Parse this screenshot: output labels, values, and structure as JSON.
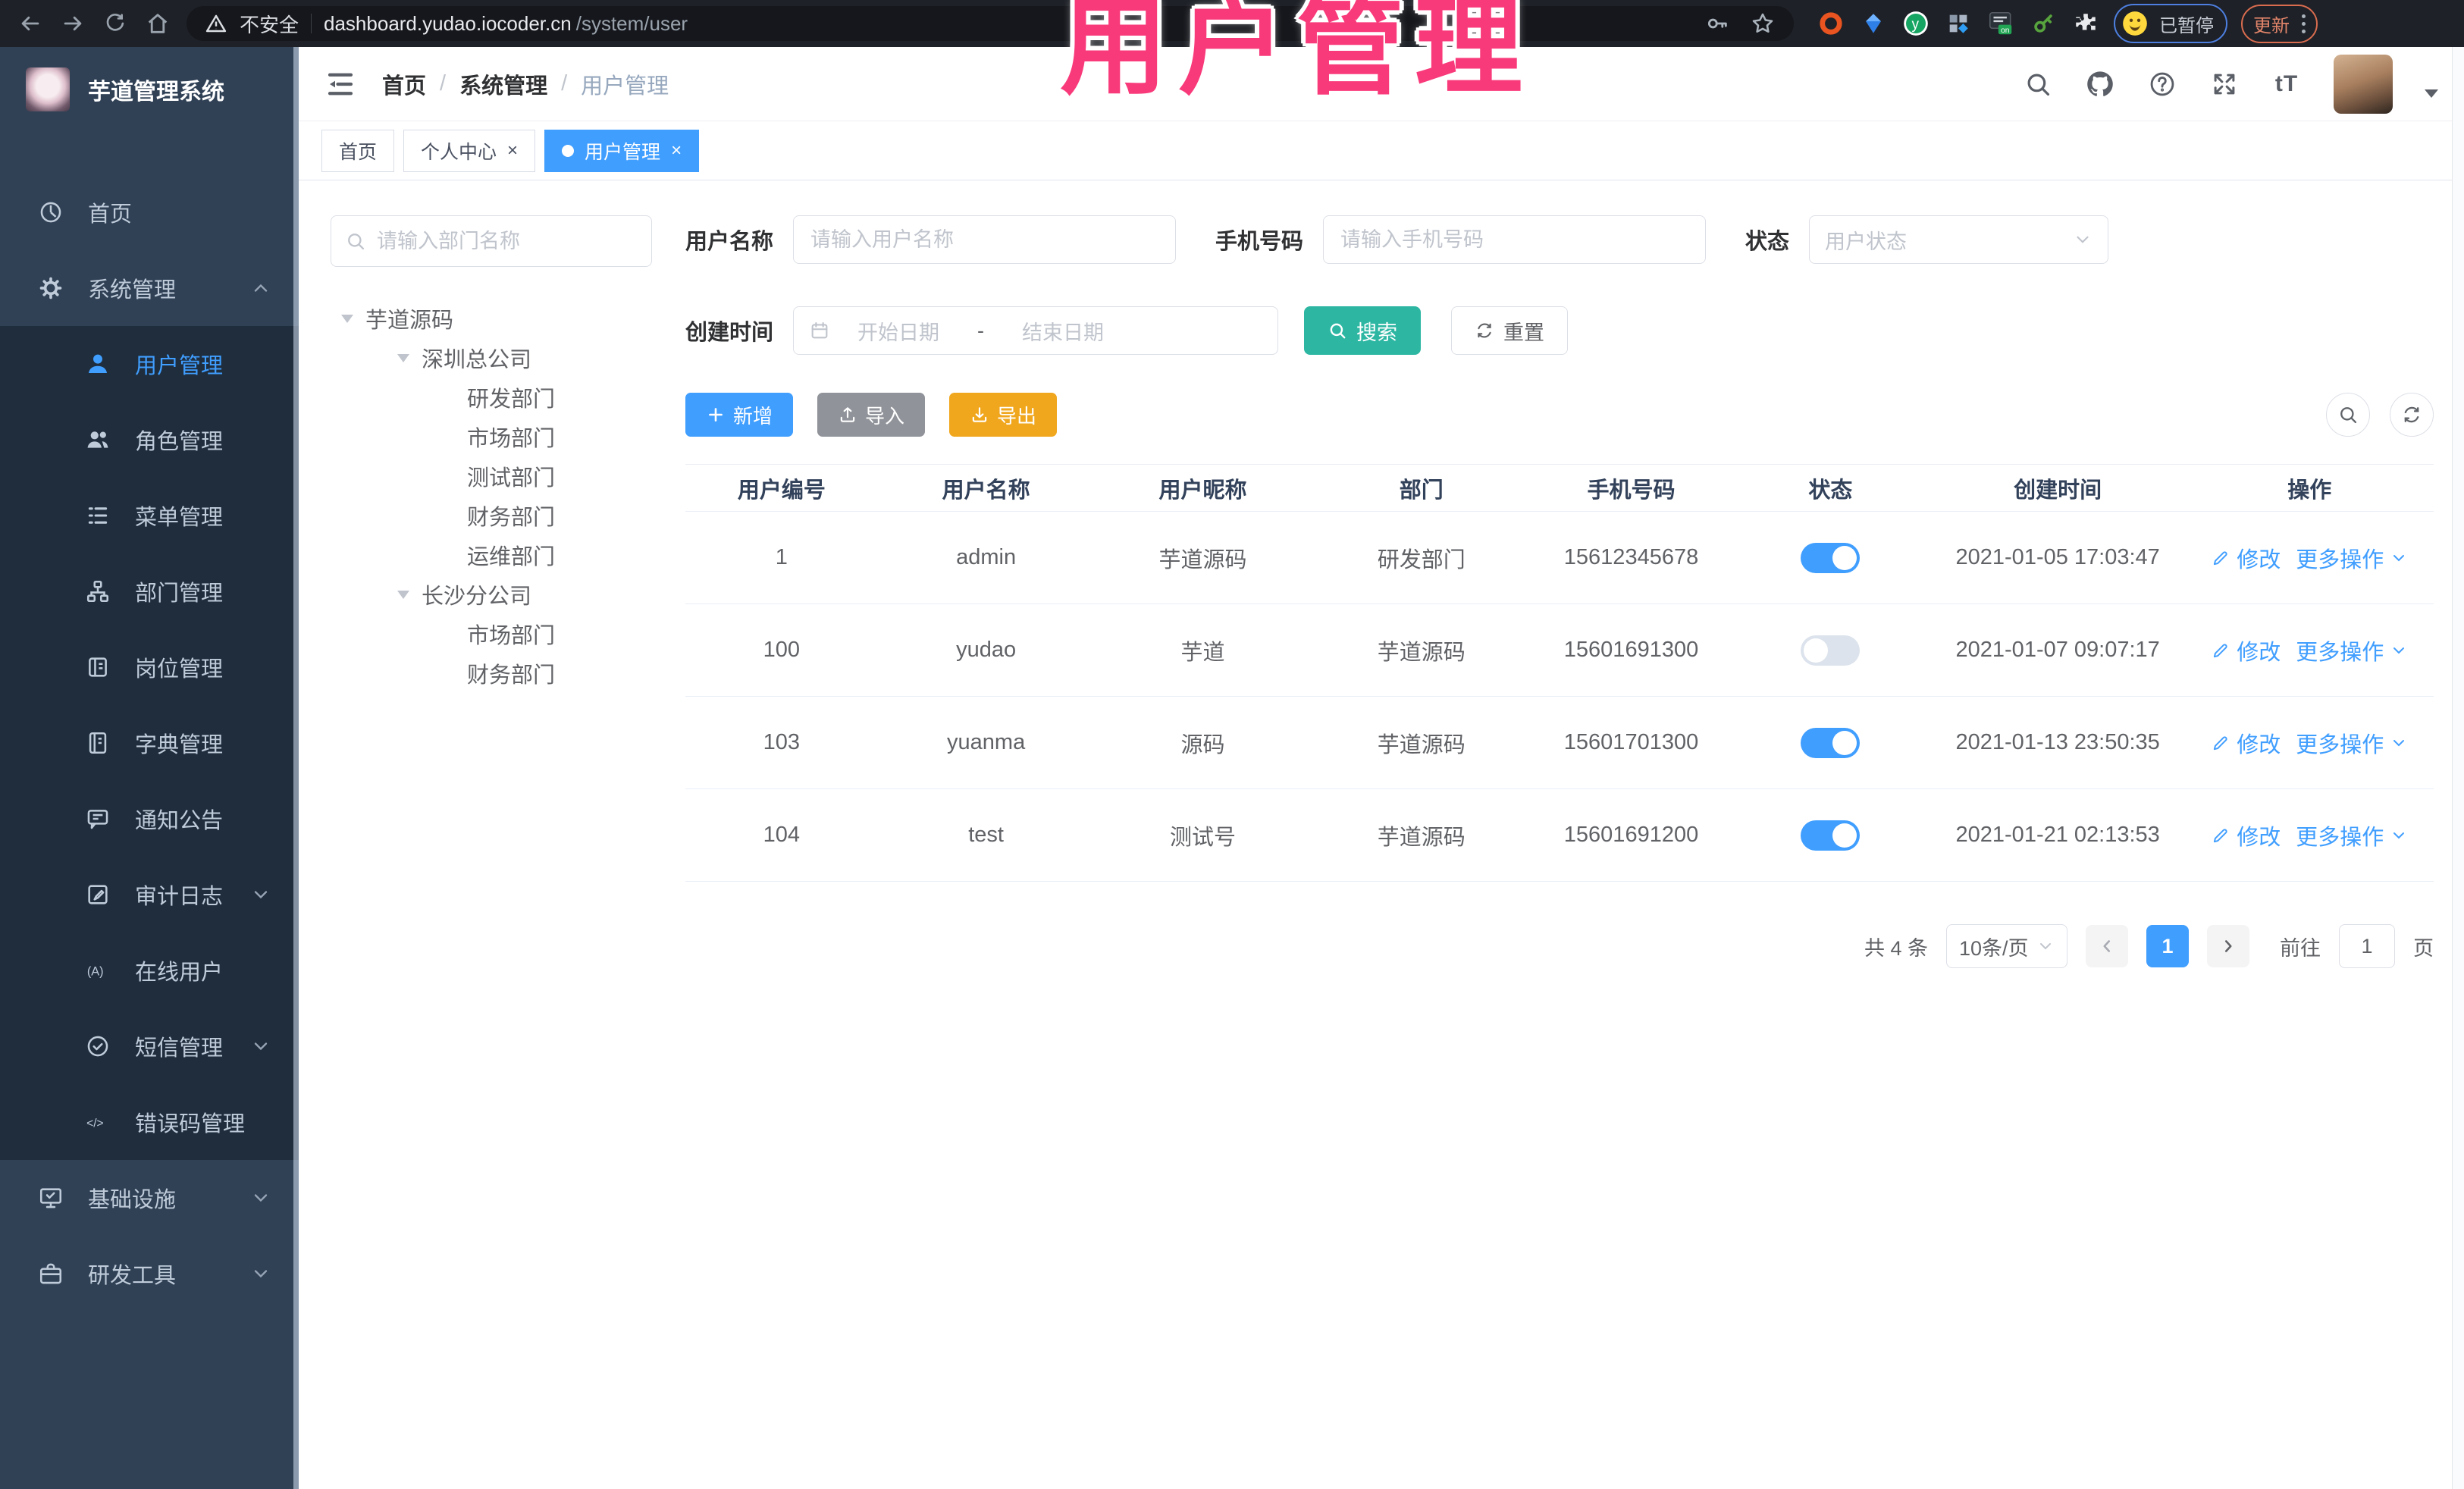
{
  "browser": {
    "security_label": "不安全",
    "url_host": "dashboard.yudao.iocoder.cn",
    "url_path": "/system/user",
    "ext_on_badge": "on",
    "ext_y_logo": "y",
    "profile_status": "已暂停",
    "update_label": "更新"
  },
  "overlay": {
    "title": "用户管理",
    "color": "#F93A7A"
  },
  "sidebar": {
    "app_title": "芋道管理系统",
    "items": [
      {
        "label": "首页",
        "icon": "dashboard-icon"
      },
      {
        "label": "系统管理",
        "icon": "gear-icon",
        "chevron": "up"
      },
      {
        "label": "用户管理",
        "icon": "user-icon",
        "active": true
      },
      {
        "label": "角色管理",
        "icon": "role-users-icon"
      },
      {
        "label": "菜单管理",
        "icon": "menu-list-icon"
      },
      {
        "label": "部门管理",
        "icon": "org-tree-icon"
      },
      {
        "label": "岗位管理",
        "icon": "post-badge-icon"
      },
      {
        "label": "字典管理",
        "icon": "dictionary-icon"
      },
      {
        "label": "通知公告",
        "icon": "announcement-icon"
      },
      {
        "label": "审计日志",
        "icon": "audit-log-icon",
        "chevron": "down"
      },
      {
        "label": "在线用户",
        "icon": "online-users-icon"
      },
      {
        "label": "短信管理",
        "icon": "sms-check-icon",
        "chevron": "down"
      },
      {
        "label": "错误码管理",
        "icon": "error-code-icon"
      },
      {
        "label": "基础设施",
        "icon": "infrastructure-icon",
        "chevron": "down"
      },
      {
        "label": "研发工具",
        "icon": "devtools-icon",
        "chevron": "down"
      }
    ]
  },
  "topnav": {
    "breadcrumb": [
      "首页",
      "系统管理",
      "用户管理"
    ],
    "separator": "/",
    "fontsize_glyph": "tT"
  },
  "tabs": {
    "items": [
      {
        "label": "首页",
        "closable": false,
        "active": false
      },
      {
        "label": "个人中心",
        "closable": true,
        "active": false
      },
      {
        "label": "用户管理",
        "closable": true,
        "active": true
      }
    ],
    "close_glyph": "×"
  },
  "dept_panel": {
    "search_placeholder": "请输入部门名称",
    "tree": [
      {
        "label": "芋道源码",
        "depth": 0,
        "expanded": true
      },
      {
        "label": "深圳总公司",
        "depth": 1,
        "expanded": true
      },
      {
        "label": "研发部门",
        "depth": 2
      },
      {
        "label": "市场部门",
        "depth": 2
      },
      {
        "label": "测试部门",
        "depth": 2
      },
      {
        "label": "财务部门",
        "depth": 2
      },
      {
        "label": "运维部门",
        "depth": 2
      },
      {
        "label": "长沙分公司",
        "depth": 1,
        "expanded": true
      },
      {
        "label": "市场部门",
        "depth": 2
      },
      {
        "label": "财务部门",
        "depth": 2
      }
    ]
  },
  "filters": {
    "username_label": "用户名称",
    "username_placeholder": "请输入用户名称",
    "mobile_label": "手机号码",
    "mobile_placeholder": "请输入手机号码",
    "status_label": "状态",
    "status_placeholder": "用户状态",
    "created_label": "创建时间",
    "date_start_placeholder": "开始日期",
    "date_separator": "-",
    "date_end_placeholder": "结束日期",
    "search_label": "搜索",
    "reset_label": "重置"
  },
  "toolbar": {
    "add_label": "新增",
    "import_label": "导入",
    "export_label": "导出"
  },
  "table": {
    "columns": [
      "用户编号",
      "用户名称",
      "用户昵称",
      "部门",
      "手机号码",
      "状态",
      "创建时间",
      "操作"
    ],
    "actions": {
      "edit": "修改",
      "more": "更多操作"
    },
    "rows": [
      {
        "id": "1",
        "username": "admin",
        "nickname": "芋道源码",
        "dept": "研发部门",
        "mobile": "15612345678",
        "status": true,
        "created": "2021-01-05 17:03:47"
      },
      {
        "id": "100",
        "username": "yudao",
        "nickname": "芋道",
        "dept": "芋道源码",
        "mobile": "15601691300",
        "status": false,
        "created": "2021-01-07 09:07:17"
      },
      {
        "id": "103",
        "username": "yuanma",
        "nickname": "源码",
        "dept": "芋道源码",
        "mobile": "15601701300",
        "status": true,
        "created": "2021-01-13 23:50:35"
      },
      {
        "id": "104",
        "username": "test",
        "nickname": "测试号",
        "dept": "芋道源码",
        "mobile": "15601691200",
        "status": true,
        "created": "2021-01-21 02:13:53"
      }
    ]
  },
  "pagination": {
    "total_label": "共 4 条",
    "page_size_label": "10条/页",
    "current_page": "1",
    "goto_label": "前往",
    "goto_value": "1",
    "page_unit": "页"
  },
  "icons_text": {
    "online_users_glyph": "(A)",
    "error_code_glyph": "</>",
    "help_glyph": "?"
  },
  "colors": {
    "primary_blue": "#409EFF",
    "search_teal": "#2DB7A3",
    "export_yellow": "#F0A71E",
    "import_gray": "#909399",
    "sidebar_bg": "#304156",
    "submenu_bg": "#1F2D3D",
    "overlay_pink": "#F93A7A"
  }
}
